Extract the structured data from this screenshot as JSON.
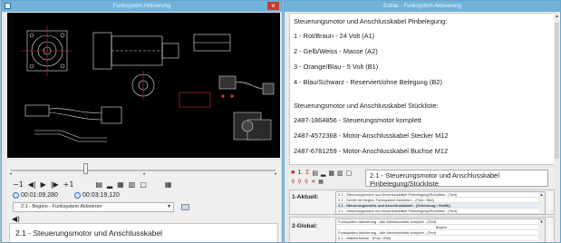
{
  "left_window": {
    "title": "Funksystem Aktivierung",
    "close_glyph": "×",
    "controls": {
      "time_elapsed": "00:01:09,280",
      "time_total": "00:03:19,120",
      "chapter_select_value": "2.1 - Beginn - Funksystem Aktivieren",
      "caption": "2.1 - Steuerungsmotor und Anschlusskabel"
    }
  },
  "right_window": {
    "title": "Extras - Funksystem Aktivierung",
    "text_lines": [
      "Steuerungsmotor und Anschlusskabel Pinbelegung:",
      "1 - Rot/Braun - 24 Volt (A1)",
      "2 - Gelb/Weiss - Masse (A2)",
      "3 - Orange/Blau - 5 Volt (B1)",
      "4 - Blau/Schwarz - Reserviert/ohne Belegung (B2)",
      "Steuerungsmotor und Anschlusskabel Stückliste:",
      "2487-1864856 - Steuerungsmotor komplett",
      "2487-4572368 - Motor-Anschlusskabel Stecker M12",
      "2487-6781259 - Motor-Anschlusskabel Buchse M12"
    ],
    "nav_title": "2.1 - Steuerungsmotor und Anschlusskabel Pinbelegung/Stückliste",
    "aktuell": {
      "label": "1-Aktuell:",
      "items": [
        "2.1 - Steuerungsmotor und Anschlusskabel Pinbelegung/Stückliste - (Text)",
        "2.1 - Schritt bei Beginn Funksystem Aktivieren - (Foto / Bild)",
        "2.1 - Steuerungsmotor und Anschlusskabel - (Zeichnung / Grafik)",
        "2.1 - Steuerungsmotor und Anschlusskabel Pinbelegung/Stückliste - (Text)"
      ]
    },
    "global": {
      "label": "2-Global:",
      "items": [
        "Funksystem Aktivierung - Alle Arbeitsschritte komplett - (Text)",
        "Beginn",
        "Funksystem Aktivierung - Alle Arbeitsschritte komplett - (Text)",
        "0.1 - Wahlfortweise - (Foto / Bild)"
      ]
    }
  },
  "colors": {
    "titlebar": "#6fb2dc",
    "close": "#c43c2c",
    "desktop": "#9ec2d8"
  }
}
